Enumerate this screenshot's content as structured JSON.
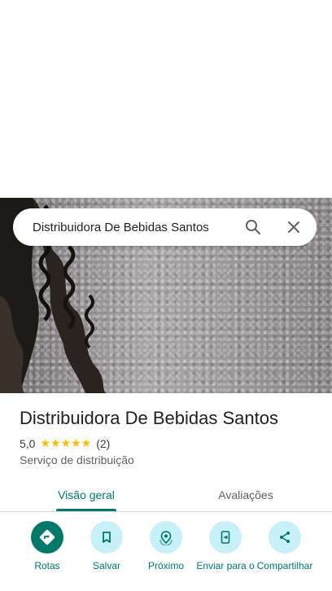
{
  "search": {
    "query": "Distribuidora De Bebidas Santos"
  },
  "place": {
    "name": "Distribuidora De Bebidas Santos",
    "rating": "5,0",
    "stars": "★★★★★",
    "review_count": "(2)",
    "category": "Serviço de distribuição"
  },
  "tabs": [
    {
      "label": "Visão geral",
      "active": true
    },
    {
      "label": "Avaliações",
      "active": false
    }
  ],
  "actions": [
    {
      "label": "Rotas",
      "icon": "directions-icon"
    },
    {
      "label": "Salvar",
      "icon": "bookmark-icon"
    },
    {
      "label": "Próximo",
      "icon": "nearby-icon"
    },
    {
      "label": "Enviar para o",
      "icon": "send-to-phone-icon"
    },
    {
      "label": "Compartilhar",
      "icon": "share-icon"
    }
  ],
  "colors": {
    "accent": "#00796b",
    "action_bg": "#c7f0f8",
    "star": "#fbbc04"
  }
}
